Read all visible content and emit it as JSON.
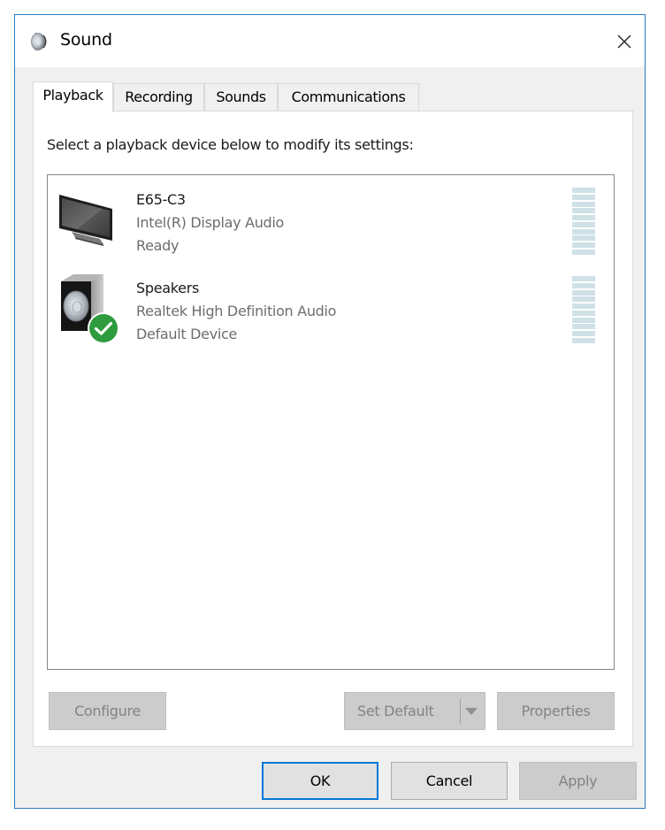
{
  "window": {
    "title": "Sound",
    "title_icon": "speaker-icon",
    "close_icon": "close-icon"
  },
  "tabs": [
    {
      "label": "Playback",
      "active": true
    },
    {
      "label": "Recording",
      "active": false
    },
    {
      "label": "Sounds",
      "active": false
    },
    {
      "label": "Communications",
      "active": false
    }
  ],
  "panel": {
    "instruction": "Select a playback device below to modify its settings:",
    "devices": [
      {
        "name": "E65-C3",
        "driver": "Intel(R) Display Audio",
        "status": "Ready",
        "icon": "monitor-icon",
        "default": false
      },
      {
        "name": "Speakers",
        "driver": "Realtek High Definition Audio",
        "status": "Default Device",
        "icon": "speaker-device-icon",
        "default": true,
        "badge_icon": "default-check-icon"
      }
    ],
    "buttons": {
      "configure": "Configure",
      "set_default": "Set Default",
      "properties": "Properties"
    }
  },
  "footer": {
    "ok": "OK",
    "cancel": "Cancel",
    "apply": "Apply"
  },
  "colors": {
    "accent": "#0078d7",
    "window_border": "#2b79c2",
    "meter": "#cfe1e7",
    "check_badge": "#2e9b3e"
  }
}
